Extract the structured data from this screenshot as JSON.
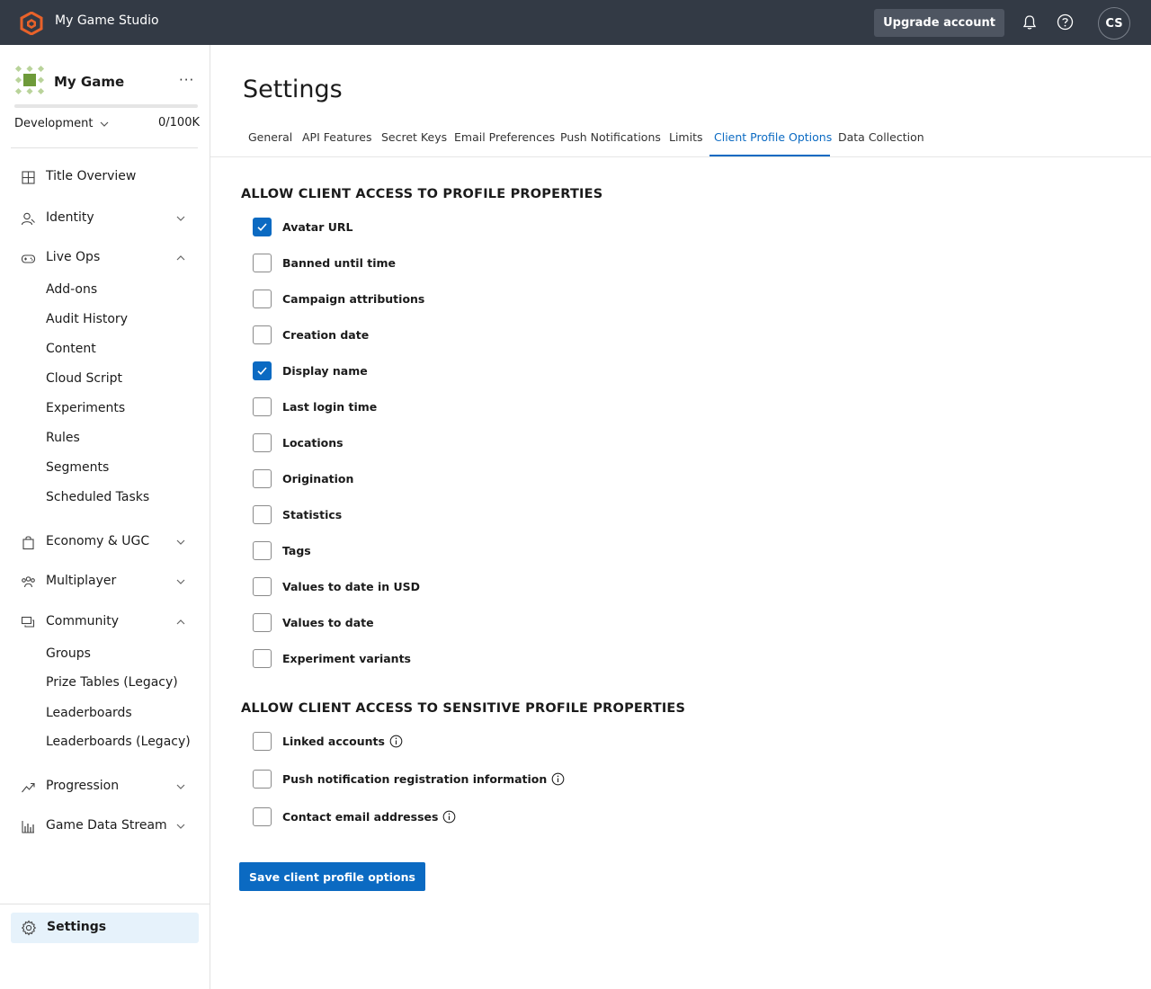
{
  "topbar": {
    "studio_name": "My Game Studio",
    "upgrade_label": "Upgrade account",
    "avatar_initials": "CS"
  },
  "sidebar": {
    "game_name": "My Game",
    "more": "···",
    "environment": "Development",
    "usage": "0/100K",
    "nav": [
      {
        "label": "Title Overview",
        "icon": "grid-icon"
      },
      {
        "label": "Identity",
        "icon": "identity-icon",
        "chevron": "down"
      },
      {
        "label": "Live Ops",
        "icon": "gamepad-icon",
        "chevron": "up"
      },
      {
        "label": "Economy & UGC",
        "icon": "shopping-bag-icon",
        "chevron": "down"
      },
      {
        "label": "Multiplayer",
        "icon": "people-icon",
        "chevron": "down"
      },
      {
        "label": "Community",
        "icon": "chat-icon",
        "chevron": "up"
      },
      {
        "label": "Progression",
        "icon": "trend-icon",
        "chevron": "down"
      },
      {
        "label": "Game Data Stream",
        "icon": "bar-chart-icon",
        "chevron": "down"
      }
    ],
    "live_ops_items": [
      "Add-ons",
      "Audit History",
      "Content",
      "Cloud Script",
      "Experiments",
      "Rules",
      "Segments",
      "Scheduled Tasks"
    ],
    "community_items": [
      "Groups",
      "Prize Tables (Legacy)",
      "Leaderboards",
      "Leaderboards (Legacy)"
    ],
    "settings_label": "Settings"
  },
  "main": {
    "title": "Settings",
    "tabs": [
      "General",
      "API Features",
      "Secret Keys",
      "Email Preferences",
      "Push Notifications",
      "Limits",
      "Client Profile Options",
      "Data Collection"
    ],
    "active_tab": "Client Profile Options",
    "section1_heading": "ALLOW CLIENT ACCESS TO PROFILE PROPERTIES",
    "section1_options": [
      {
        "label": "Avatar URL",
        "checked": true
      },
      {
        "label": "Banned until time",
        "checked": false
      },
      {
        "label": "Campaign attributions",
        "checked": false
      },
      {
        "label": "Creation date",
        "checked": false
      },
      {
        "label": "Display name",
        "checked": true
      },
      {
        "label": "Last login time",
        "checked": false
      },
      {
        "label": "Locations",
        "checked": false
      },
      {
        "label": "Origination",
        "checked": false
      },
      {
        "label": "Statistics",
        "checked": false
      },
      {
        "label": "Tags",
        "checked": false
      },
      {
        "label": "Values to date in USD",
        "checked": false
      },
      {
        "label": "Values to date",
        "checked": false
      },
      {
        "label": "Experiment variants",
        "checked": false
      }
    ],
    "section2_heading": "ALLOW CLIENT ACCESS TO SENSITIVE PROFILE PROPERTIES",
    "section2_options": [
      {
        "label": "Linked accounts",
        "checked": false
      },
      {
        "label": "Push notification registration information",
        "checked": false
      },
      {
        "label": "Contact email addresses",
        "checked": false
      }
    ],
    "save_label": "Save client profile options"
  },
  "colors": {
    "topbar_bg": "#333a45",
    "accent": "#0b6ac2",
    "brand_orange": "#e8622a",
    "selected_nav_bg": "#e6f2fb"
  }
}
